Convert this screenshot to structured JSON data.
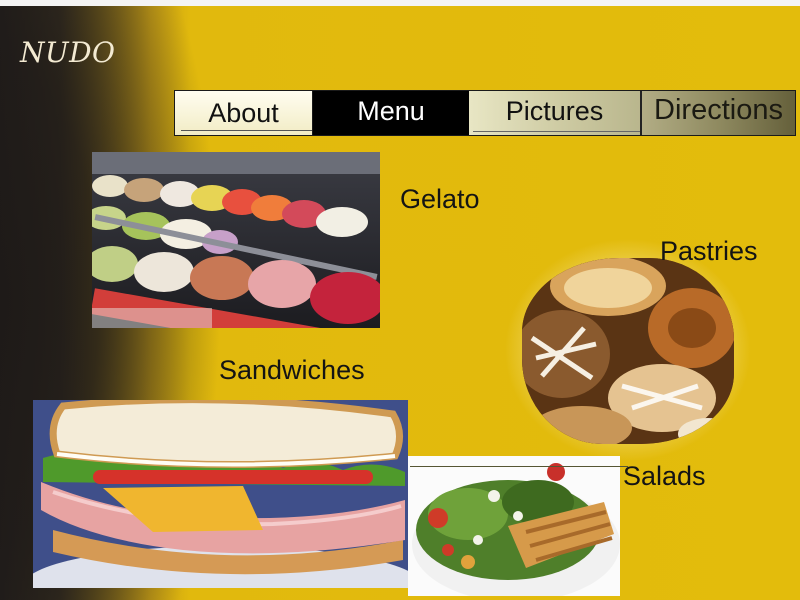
{
  "site": {
    "logo": "NUDO"
  },
  "nav": {
    "items": [
      {
        "label": "About"
      },
      {
        "label": "Menu"
      },
      {
        "label": "Pictures"
      },
      {
        "label": "Directions"
      }
    ],
    "active": "Menu"
  },
  "menu": {
    "gelato": {
      "label": "Gelato",
      "image_icon": "gelato-display-photo"
    },
    "pastries": {
      "label": "Pastries",
      "image_icon": "pastries-photo"
    },
    "sandwiches": {
      "label": "Sandwiches",
      "image_icon": "sandwich-photo"
    },
    "salads": {
      "label": "Salads",
      "image_icon": "salad-photo"
    }
  },
  "colors": {
    "background": "#e0b80f",
    "dark_edge": "#231f1d",
    "active_nav": "#000000",
    "text": "#141414",
    "logo": "#f3ead2"
  }
}
